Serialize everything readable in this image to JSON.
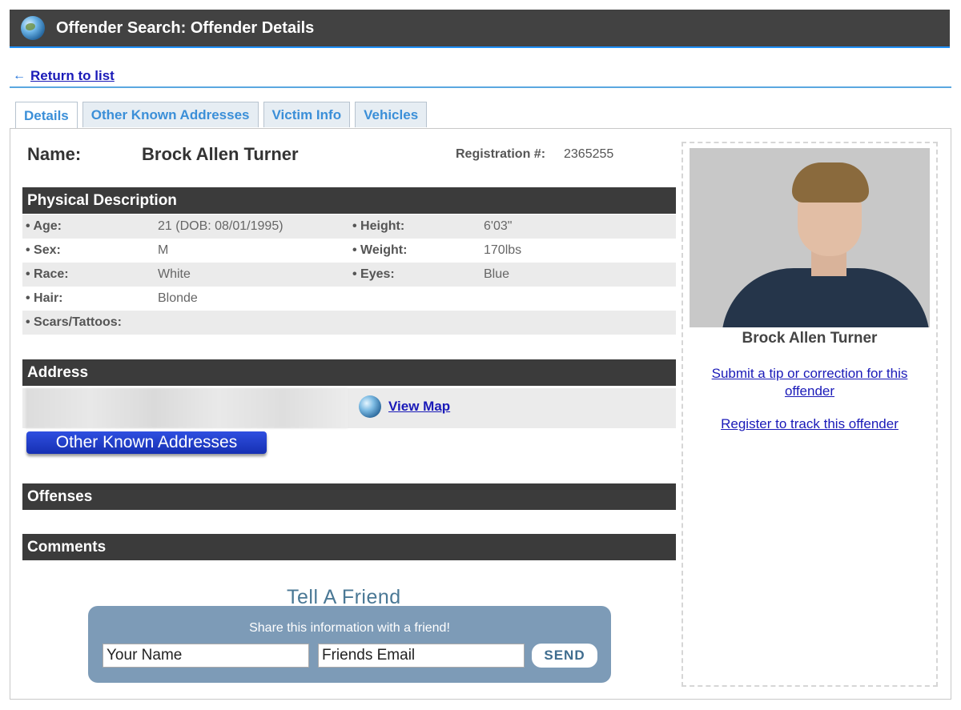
{
  "header": {
    "title": "Offender Search: Offender Details",
    "icon": "globe-icon"
  },
  "nav": {
    "return_arrow": "←",
    "return_label": "Return to list"
  },
  "tabs": [
    {
      "label": "Details",
      "active": true
    },
    {
      "label": "Other Known Addresses",
      "active": false
    },
    {
      "label": "Victim Info",
      "active": false
    },
    {
      "label": "Vehicles",
      "active": false
    }
  ],
  "offender": {
    "name_label": "Name:",
    "name": "Brock Allen Turner",
    "registration_label": "Registration #:",
    "registration_number": "2365255"
  },
  "physical": {
    "title": "Physical Description",
    "rows": [
      {
        "k1": "• Age:",
        "v1": "21  (DOB: 08/01/1995)",
        "k2": "• Height:",
        "v2": "6'03\""
      },
      {
        "k1": "• Sex:",
        "v1": "M",
        "k2": "• Weight:",
        "v2": "170lbs"
      },
      {
        "k1": "• Race:",
        "v1": "White",
        "k2": "• Eyes:",
        "v2": "Blue"
      },
      {
        "k1": "• Hair:",
        "v1": "Blonde",
        "k2": "",
        "v2": ""
      },
      {
        "k1": "• Scars/Tattoos:",
        "v1": "",
        "k2": "",
        "v2": ""
      }
    ]
  },
  "address": {
    "title": "Address",
    "view_map_label": "View Map",
    "other_addresses_button": "Other Known Addresses"
  },
  "offenses": {
    "title": "Offenses"
  },
  "comments": {
    "title": "Comments"
  },
  "tell_friend": {
    "title": "Tell A Friend",
    "prompt": "Share this information with a friend!",
    "name_value": "Your Name",
    "email_value": "Friends Email",
    "send_label": "SEND"
  },
  "sidebar": {
    "photo_name": "Brock Allen Turner",
    "tip_link": "Submit a tip or correction for this offender",
    "track_link": "Register to track this offender"
  },
  "colors": {
    "header_bg": "#424242",
    "section_bg": "#3b3b3b",
    "link": "#1a1ab8",
    "tab_text": "#3b8fd8",
    "button_blue": "#1630b3",
    "friend_box": "#7d9bb7"
  }
}
